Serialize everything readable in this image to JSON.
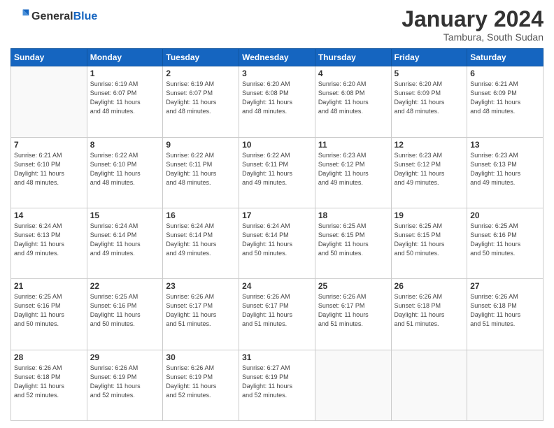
{
  "logo": {
    "general": "General",
    "blue": "Blue"
  },
  "header": {
    "month": "January 2024",
    "location": "Tambura, South Sudan"
  },
  "weekdays": [
    "Sunday",
    "Monday",
    "Tuesday",
    "Wednesday",
    "Thursday",
    "Friday",
    "Saturday"
  ],
  "weeks": [
    [
      {
        "day": "",
        "info": ""
      },
      {
        "day": "1",
        "info": "Sunrise: 6:19 AM\nSunset: 6:07 PM\nDaylight: 11 hours\nand 48 minutes."
      },
      {
        "day": "2",
        "info": "Sunrise: 6:19 AM\nSunset: 6:07 PM\nDaylight: 11 hours\nand 48 minutes."
      },
      {
        "day": "3",
        "info": "Sunrise: 6:20 AM\nSunset: 6:08 PM\nDaylight: 11 hours\nand 48 minutes."
      },
      {
        "day": "4",
        "info": "Sunrise: 6:20 AM\nSunset: 6:08 PM\nDaylight: 11 hours\nand 48 minutes."
      },
      {
        "day": "5",
        "info": "Sunrise: 6:20 AM\nSunset: 6:09 PM\nDaylight: 11 hours\nand 48 minutes."
      },
      {
        "day": "6",
        "info": "Sunrise: 6:21 AM\nSunset: 6:09 PM\nDaylight: 11 hours\nand 48 minutes."
      }
    ],
    [
      {
        "day": "7",
        "info": "Sunrise: 6:21 AM\nSunset: 6:10 PM\nDaylight: 11 hours\nand 48 minutes."
      },
      {
        "day": "8",
        "info": "Sunrise: 6:22 AM\nSunset: 6:10 PM\nDaylight: 11 hours\nand 48 minutes."
      },
      {
        "day": "9",
        "info": "Sunrise: 6:22 AM\nSunset: 6:11 PM\nDaylight: 11 hours\nand 48 minutes."
      },
      {
        "day": "10",
        "info": "Sunrise: 6:22 AM\nSunset: 6:11 PM\nDaylight: 11 hours\nand 49 minutes."
      },
      {
        "day": "11",
        "info": "Sunrise: 6:23 AM\nSunset: 6:12 PM\nDaylight: 11 hours\nand 49 minutes."
      },
      {
        "day": "12",
        "info": "Sunrise: 6:23 AM\nSunset: 6:12 PM\nDaylight: 11 hours\nand 49 minutes."
      },
      {
        "day": "13",
        "info": "Sunrise: 6:23 AM\nSunset: 6:13 PM\nDaylight: 11 hours\nand 49 minutes."
      }
    ],
    [
      {
        "day": "14",
        "info": "Sunrise: 6:24 AM\nSunset: 6:13 PM\nDaylight: 11 hours\nand 49 minutes."
      },
      {
        "day": "15",
        "info": "Sunrise: 6:24 AM\nSunset: 6:14 PM\nDaylight: 11 hours\nand 49 minutes."
      },
      {
        "day": "16",
        "info": "Sunrise: 6:24 AM\nSunset: 6:14 PM\nDaylight: 11 hours\nand 49 minutes."
      },
      {
        "day": "17",
        "info": "Sunrise: 6:24 AM\nSunset: 6:14 PM\nDaylight: 11 hours\nand 50 minutes."
      },
      {
        "day": "18",
        "info": "Sunrise: 6:25 AM\nSunset: 6:15 PM\nDaylight: 11 hours\nand 50 minutes."
      },
      {
        "day": "19",
        "info": "Sunrise: 6:25 AM\nSunset: 6:15 PM\nDaylight: 11 hours\nand 50 minutes."
      },
      {
        "day": "20",
        "info": "Sunrise: 6:25 AM\nSunset: 6:16 PM\nDaylight: 11 hours\nand 50 minutes."
      }
    ],
    [
      {
        "day": "21",
        "info": "Sunrise: 6:25 AM\nSunset: 6:16 PM\nDaylight: 11 hours\nand 50 minutes."
      },
      {
        "day": "22",
        "info": "Sunrise: 6:25 AM\nSunset: 6:16 PM\nDaylight: 11 hours\nand 50 minutes."
      },
      {
        "day": "23",
        "info": "Sunrise: 6:26 AM\nSunset: 6:17 PM\nDaylight: 11 hours\nand 51 minutes."
      },
      {
        "day": "24",
        "info": "Sunrise: 6:26 AM\nSunset: 6:17 PM\nDaylight: 11 hours\nand 51 minutes."
      },
      {
        "day": "25",
        "info": "Sunrise: 6:26 AM\nSunset: 6:17 PM\nDaylight: 11 hours\nand 51 minutes."
      },
      {
        "day": "26",
        "info": "Sunrise: 6:26 AM\nSunset: 6:18 PM\nDaylight: 11 hours\nand 51 minutes."
      },
      {
        "day": "27",
        "info": "Sunrise: 6:26 AM\nSunset: 6:18 PM\nDaylight: 11 hours\nand 51 minutes."
      }
    ],
    [
      {
        "day": "28",
        "info": "Sunrise: 6:26 AM\nSunset: 6:18 PM\nDaylight: 11 hours\nand 52 minutes."
      },
      {
        "day": "29",
        "info": "Sunrise: 6:26 AM\nSunset: 6:19 PM\nDaylight: 11 hours\nand 52 minutes."
      },
      {
        "day": "30",
        "info": "Sunrise: 6:26 AM\nSunset: 6:19 PM\nDaylight: 11 hours\nand 52 minutes."
      },
      {
        "day": "31",
        "info": "Sunrise: 6:27 AM\nSunset: 6:19 PM\nDaylight: 11 hours\nand 52 minutes."
      },
      {
        "day": "",
        "info": ""
      },
      {
        "day": "",
        "info": ""
      },
      {
        "day": "",
        "info": ""
      }
    ]
  ]
}
